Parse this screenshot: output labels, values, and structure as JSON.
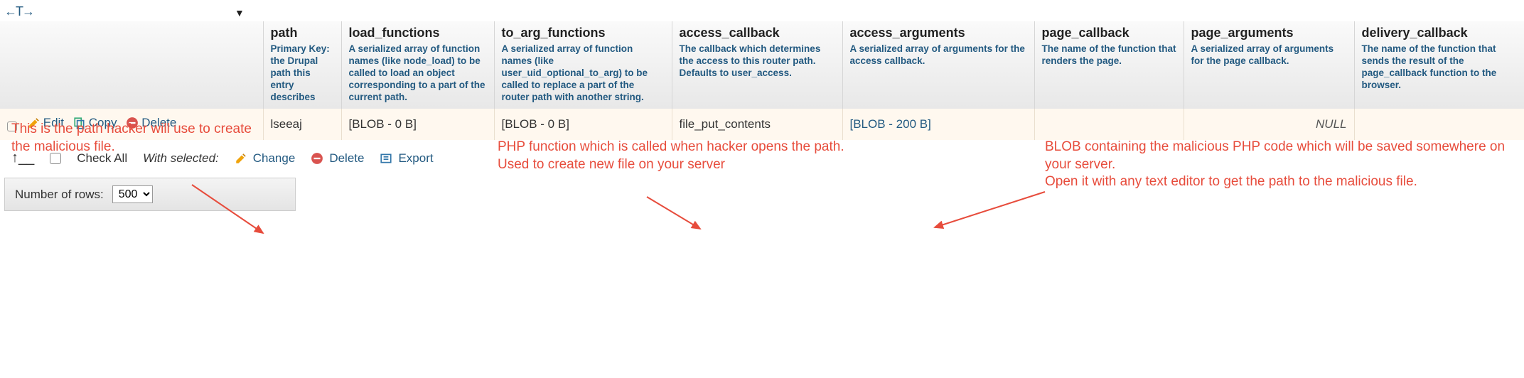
{
  "top_icon": "←T→",
  "columns": [
    {
      "name": "path",
      "desc": "Primary Key: the Drupal path this entry describes"
    },
    {
      "name": "load_functions",
      "desc": "A serialized array of function names (like node_load) to be called to load an object corresponding to a part of the current path."
    },
    {
      "name": "to_arg_functions",
      "desc": "A serialized array of function names (like user_uid_optional_to_arg) to be called to replace a part of the router path with another string."
    },
    {
      "name": "access_callback",
      "desc": "The callback which determines the access to this router path. Defaults to user_access."
    },
    {
      "name": "access_arguments",
      "desc": "A serialized array of arguments for the access callback."
    },
    {
      "name": "page_callback",
      "desc": "The name of the function that renders the page."
    },
    {
      "name": "page_arguments",
      "desc": "A serialized array of arguments for the page callback."
    },
    {
      "name": "delivery_callback",
      "desc": "The name of the function that sends the result of the page_callback function to the browser."
    }
  ],
  "row": {
    "actions": {
      "edit": "Edit",
      "copy": "Copy",
      "delete": "Delete"
    },
    "path": "lseeaj",
    "load_functions": "[BLOB - 0 B]",
    "to_arg_functions": "[BLOB - 0 B]",
    "access_callback": "file_put_contents",
    "access_arguments": "[BLOB - 200 B]",
    "page_callback": "",
    "page_arguments": "NULL",
    "delivery_callback": ""
  },
  "annotations": {
    "a1": "This is the path hacker will use to create the malicious file.",
    "a2": "PHP function which is called when hacker opens the path.\nUsed to create new file on your server",
    "a3": "BLOB containing the malicious PHP code which will be saved somewhere on your server.\nOpen it with any text editor to get the path to the malicious file."
  },
  "below": {
    "check_all": "Check All",
    "with_selected": "With selected:",
    "change": "Change",
    "delete": "Delete",
    "export": "Export"
  },
  "rows_control": {
    "label": "Number of rows:",
    "value": "500"
  }
}
